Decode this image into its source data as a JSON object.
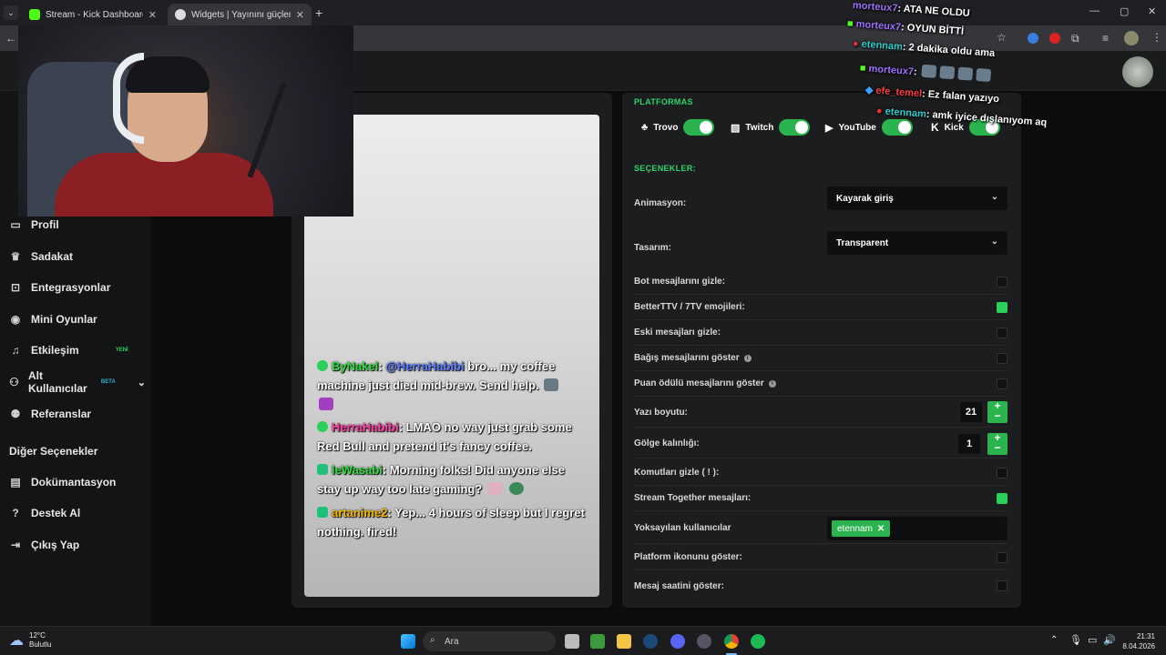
{
  "browser": {
    "tabs": [
      {
        "title": "Stream - Kick Dashboard",
        "icon_color": "#53fc18"
      },
      {
        "title": "Widgets | Yayınını güçlendirme!",
        "icon_color": "#ffffff"
      }
    ],
    "new_tab": "+",
    "window": {
      "minimize": "—",
      "maximize": "▢",
      "close": "✕"
    }
  },
  "sidebar": {
    "items": [
      {
        "label": "Profil",
        "icon": "id-card-icon"
      },
      {
        "label": "Sadakat",
        "icon": "trophy-icon"
      },
      {
        "label": "Entegrasyonlar",
        "icon": "plug-icon"
      },
      {
        "label": "Mini Oyunlar",
        "icon": "gamepad-icon"
      },
      {
        "label": "Etkileşim",
        "icon": "music-icon",
        "badge": "YENİ",
        "badge_color": "#2bd05a"
      },
      {
        "label": "Alt Kullanıcılar",
        "icon": "users-icon",
        "badge": "BETA",
        "badge_color": "#2bb3d0",
        "chevron": "⌄"
      },
      {
        "label": "Referanslar",
        "icon": "user-group-icon"
      }
    ],
    "other_heading": "Diğer Seçenekler",
    "other_items": [
      {
        "label": "Dokümantasyon",
        "icon": "book-icon"
      },
      {
        "label": "Destek Al",
        "icon": "question-icon"
      },
      {
        "label": "Çıkış Yap",
        "icon": "logout-icon"
      }
    ]
  },
  "preview": {
    "messages": [
      {
        "user": "ByNakel",
        "user_color": "#33dd44",
        "platform": "kick",
        "text_pre": ": ",
        "mention": "@HerraHabibi",
        "text": " bro... my coffee machine just died mid-brew. Send help."
      },
      {
        "user": "HerraHabibi",
        "user_color": "#ff3fa8",
        "platform": "kick",
        "text_pre": ": ",
        "text": "LMAO no way  just grab some Red Bull and pretend it's fancy coffee."
      },
      {
        "user": "leWasabi",
        "user_color": "#33dd44",
        "platform": "trovo",
        "text_pre": ": ",
        "text": "Morning folks! Did anyone else stay up way too late gaming?"
      },
      {
        "user": "artanime2",
        "user_color": "#f5b800",
        "platform": "trovo",
        "text_pre": ": ",
        "text": "Yep... 4 hours of sleep but I regret nothing. fired!"
      }
    ]
  },
  "settings": {
    "platforms_title": "PLATFORMAS",
    "platforms": [
      {
        "name": "Trovo",
        "enabled": true
      },
      {
        "name": "Twitch",
        "enabled": true
      },
      {
        "name": "YouTube",
        "enabled": true
      },
      {
        "name": "Kick",
        "enabled": true
      }
    ],
    "options_title": "SEÇENEKLER:",
    "animation_label": "Animasyon:",
    "animation_value": "Kayarak giriş",
    "design_label": "Tasarım:",
    "design_value": "Transparent",
    "rows": [
      {
        "label": "Bot mesajlarını gizle:",
        "checked": false
      },
      {
        "label": "BetterTTV / 7TV emojileri:",
        "checked": true
      },
      {
        "label": "Eski mesajları gizle:",
        "checked": false
      },
      {
        "label": "Bağış mesajlarını göster",
        "checked": false,
        "info": true
      },
      {
        "label": "Puan ödülü mesajlarını göster",
        "checked": false,
        "info": true
      }
    ],
    "font_size_label": "Yazı boyutu:",
    "font_size_value": "21",
    "shadow_label": "Gölge kalınlığı:",
    "shadow_value": "1",
    "rows2": [
      {
        "label": "Komutları gizle ( ! ):",
        "checked": false
      },
      {
        "label": "Stream Together mesajları:",
        "checked": true
      }
    ],
    "ignored_label": "Yoksayılan kullanıcılar",
    "ignored_users": [
      "etennam"
    ],
    "rows3": [
      {
        "label": "Platform ikonunu göster:",
        "checked": false
      },
      {
        "label": "Mesaj saatini göster:",
        "checked": false
      }
    ]
  },
  "overlay_chat": [
    {
      "user": "morteux7",
      "user_color": "#a070ff",
      "text": ": ATA NE OLDU"
    },
    {
      "user": "morteux7",
      "user_color": "#a070ff",
      "text": ": OYUN BİTTİ"
    },
    {
      "user": "etennam",
      "user_color": "#2bd0d0",
      "text": ": 2 dakika oldu ama"
    },
    {
      "user": "morteux7",
      "user_color": "#a070ff",
      "text": ":"
    },
    {
      "user": "efe_temel",
      "user_color": "#ff4040",
      "text": ": Ez falan yazıyo"
    },
    {
      "user": "etennam",
      "user_color": "#2bd0d0",
      "text": ": amk iyice dışlanıyom aq"
    }
  ],
  "taskbar": {
    "weather_temp": "12°C",
    "weather_desc": "Bulutlu",
    "search_placeholder": "Ara",
    "time": "21:31",
    "date": "8.04.2026"
  }
}
